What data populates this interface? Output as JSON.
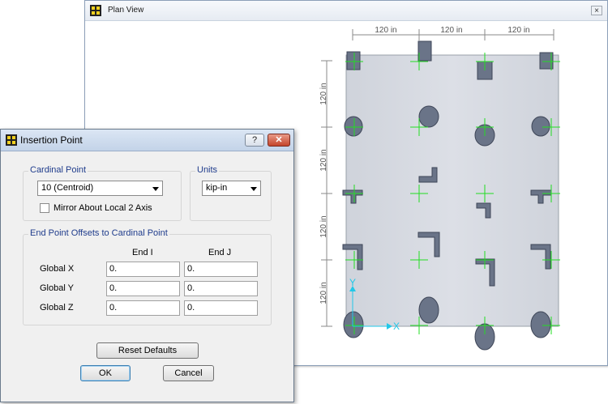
{
  "plan_view": {
    "title": "Plan View",
    "close_glyph": "×",
    "dimensions": {
      "horizontal": [
        "120 in",
        "120 in",
        "120 in"
      ],
      "vertical": [
        "120 in",
        "120 in",
        "120 in",
        "120 in"
      ]
    },
    "axis_x": "X",
    "axis_y": "Y"
  },
  "dialog": {
    "title": "Insertion Point",
    "help_glyph": "?",
    "close_glyph": "✕",
    "cardinal_point": {
      "group_label": "Cardinal Point",
      "selected": "10 (Centroid)",
      "mirror_label": "Mirror About Local 2 Axis",
      "mirror_checked": false
    },
    "units": {
      "group_label": "Units",
      "selected": "kip-in"
    },
    "offsets": {
      "group_label": "End Point Offsets to Cardinal Point",
      "col_end_i": "End I",
      "col_end_j": "End J",
      "rows": [
        {
          "label": "Global X",
          "end_i": "0.",
          "end_j": "0."
        },
        {
          "label": "Global Y",
          "end_i": "0.",
          "end_j": "0."
        },
        {
          "label": "Global Z",
          "end_i": "0.",
          "end_j": "0."
        }
      ]
    },
    "reset_label": "Reset Defaults",
    "ok_label": "OK",
    "cancel_label": "Cancel"
  },
  "colors": {
    "slab": "#d4d8e0",
    "section": "#6a7488",
    "crosshair": "#22dd22",
    "axis": "#22c8e8"
  },
  "icons": [
    "app-grid-icon",
    "close-icon",
    "help-icon",
    "dropdown-arrow-icon"
  ]
}
